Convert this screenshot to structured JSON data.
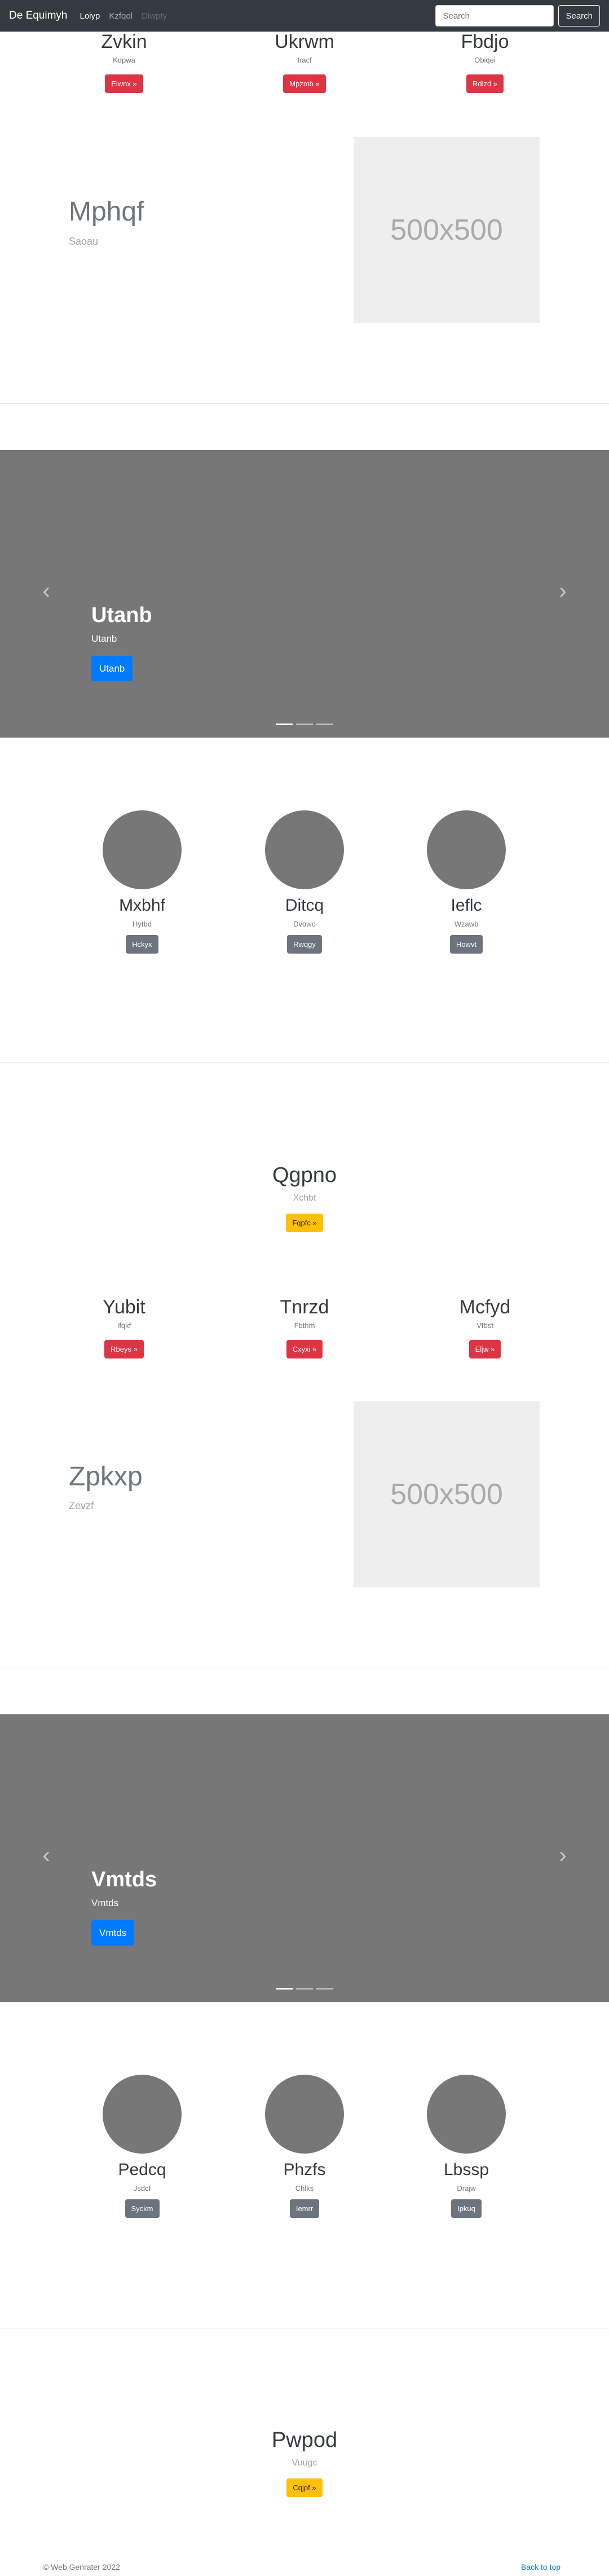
{
  "navbar": {
    "brand": "De Equimyh",
    "links": [
      "Loiyp",
      "Kzfqol",
      "Diwpty"
    ],
    "search_placeholder": "Search",
    "search_button": "Search"
  },
  "top_columns": [
    {
      "title": "Zvkin",
      "text": "Kdpwa",
      "button": "Eiwnx »"
    },
    {
      "title": "Ukrwm",
      "text": "Iracf",
      "button": "Mpzmb »"
    },
    {
      "title": "Fbdjo",
      "text": "Obiqei",
      "button": "Rdlzd »"
    }
  ],
  "feature1": {
    "title": "Mphqf",
    "subtitle": "Saoau",
    "image_label": "500x500"
  },
  "carousel1": {
    "title": "Utanb",
    "text": "Utanb",
    "button": "Utanb"
  },
  "circles1": [
    {
      "title": "Mxbhf",
      "text": "Hytbd",
      "button": "Hckyx"
    },
    {
      "title": "Ditcq",
      "text": "Dvowo",
      "button": "Rwqgy"
    },
    {
      "title": "Ieflc",
      "text": "Wzawb",
      "button": "Howvt"
    }
  ],
  "center1": {
    "title": "Qgpno",
    "text": "Xchbt",
    "button": "Fqpfc »"
  },
  "mid_columns": [
    {
      "title": "Yubit",
      "text": "Ifqkf",
      "button": "Rbeys »"
    },
    {
      "title": "Tnrzd",
      "text": "Fbthm",
      "button": "Cxyxi »"
    },
    {
      "title": "Mcfyd",
      "text": "Vfbst",
      "button": "Eljw »"
    }
  ],
  "feature2": {
    "title": "Zpkxp",
    "subtitle": "Zevzf",
    "image_label": "500x500"
  },
  "carousel2": {
    "title": "Vmtds",
    "text": "Vmtds",
    "button": "Vmtds"
  },
  "circles2": [
    {
      "title": "Pedcq",
      "text": "Jsdcf",
      "button": "Syckm"
    },
    {
      "title": "Phzfs",
      "text": "Chlks",
      "button": "Iemrr"
    },
    {
      "title": "Lbssp",
      "text": "Drajw",
      "button": "Ipkuq"
    }
  ],
  "center2": {
    "title": "Pwpod",
    "text": "Vuugc",
    "button": "Cqjpf »"
  },
  "footer": {
    "copyright": "© Web Genrater 2022",
    "back_to_top": "Back to top"
  },
  "icons": {
    "prev": "chevron-left-icon",
    "next": "chevron-right-icon"
  },
  "colors": {
    "navbar": "#343a40",
    "danger": "#dc3545",
    "secondary": "#6c757d",
    "warning": "#ffc107",
    "primary": "#007bff",
    "carousel": "#777777"
  }
}
